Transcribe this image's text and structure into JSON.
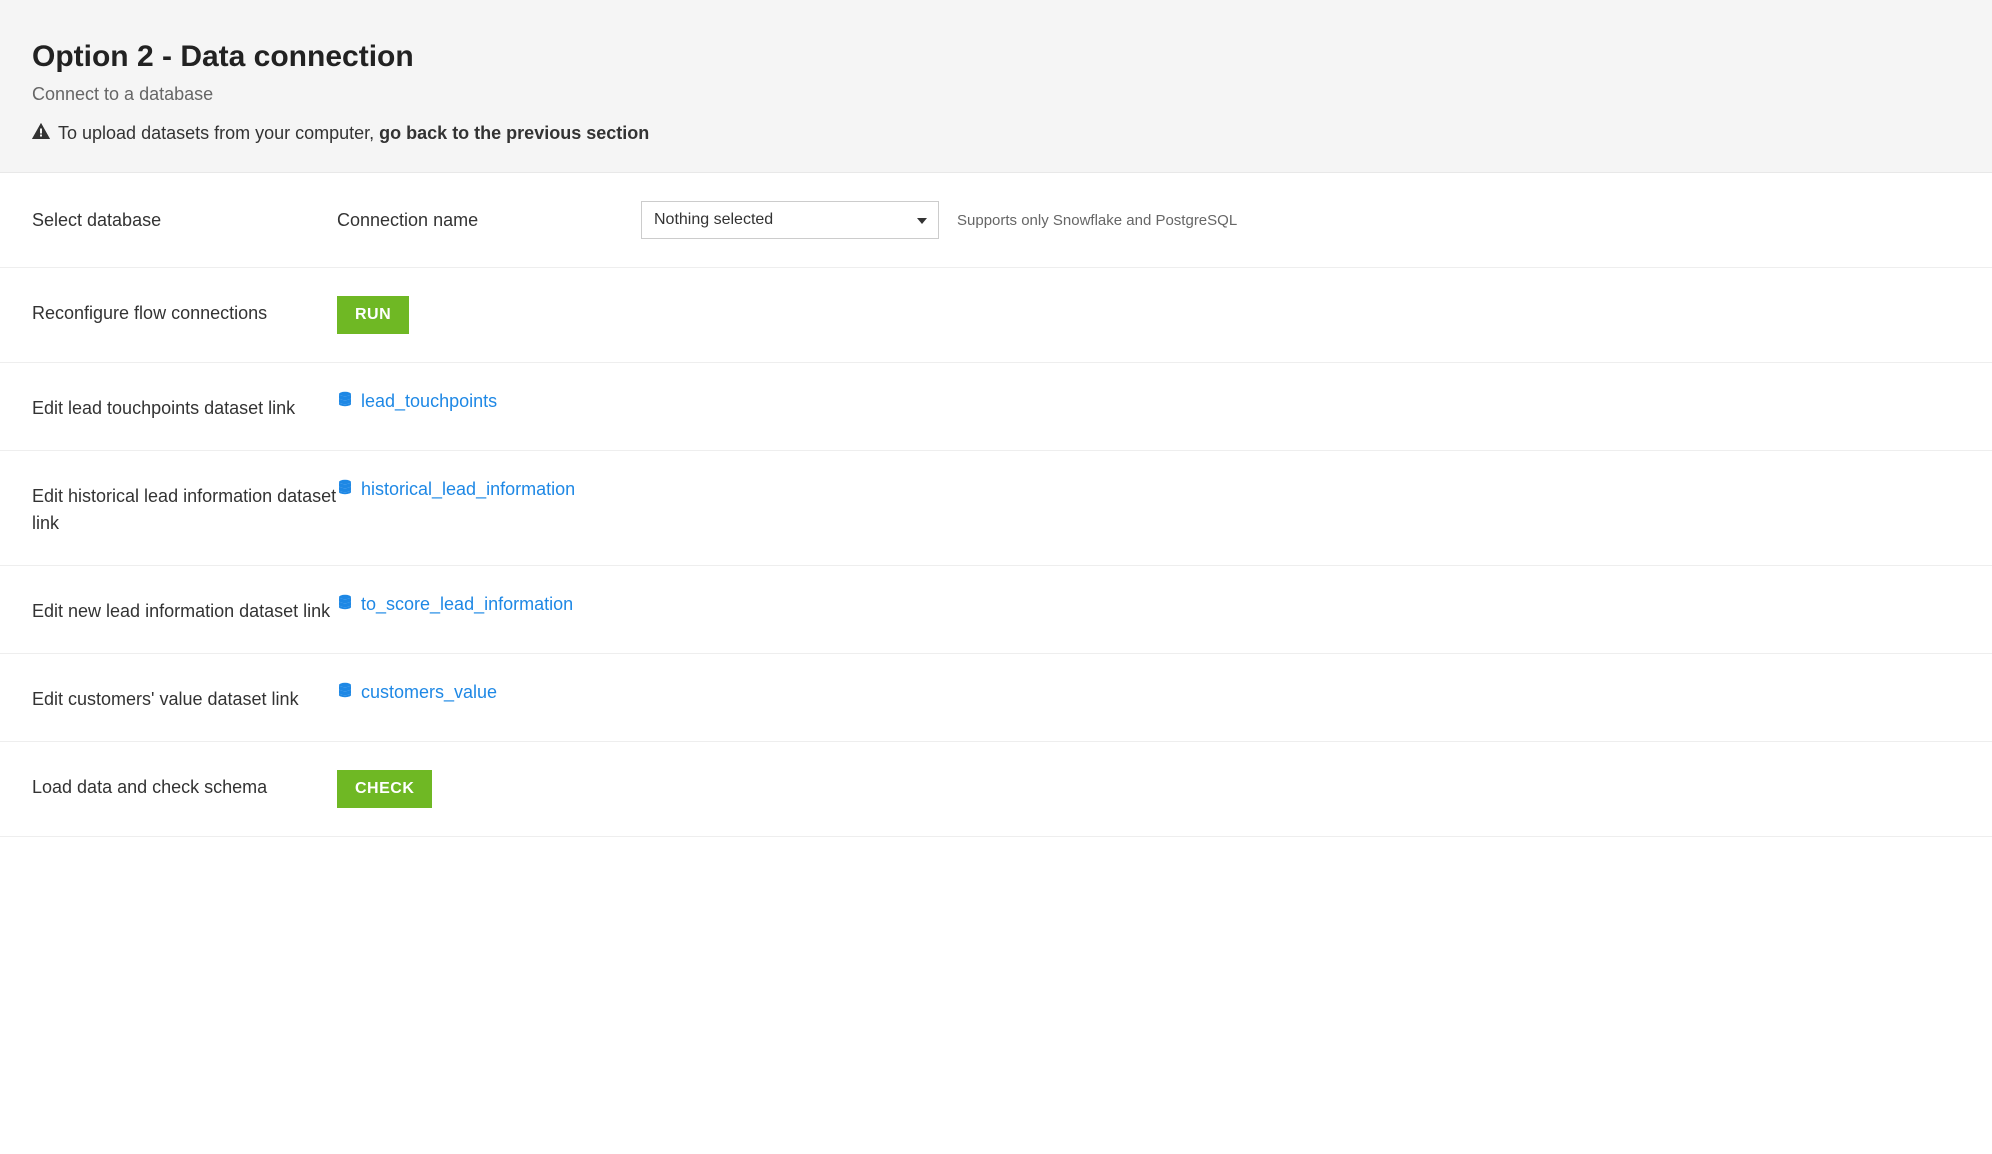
{
  "header": {
    "title": "Option 2 - Data connection",
    "subtitle": "Connect to a database",
    "warning_prefix": "To upload datasets from your computer, ",
    "warning_bold": "go back to the previous section"
  },
  "select_db": {
    "label": "Select database",
    "connection_label": "Connection name",
    "selected": "Nothing selected",
    "help": "Supports only Snowflake and PostgreSQL"
  },
  "reconfigure": {
    "label": "Reconfigure flow connections",
    "button": "RUN"
  },
  "datasets": [
    {
      "label": "Edit lead touchpoints dataset link",
      "name": "lead_touchpoints"
    },
    {
      "label": "Edit historical lead information dataset link",
      "name": "historical_lead_information"
    },
    {
      "label": "Edit new lead information dataset link",
      "name": "to_score_lead_information"
    },
    {
      "label": "Edit customers' value dataset link",
      "name": "customers_value"
    }
  ],
  "load": {
    "label": "Load data and check schema",
    "button": "CHECK"
  }
}
